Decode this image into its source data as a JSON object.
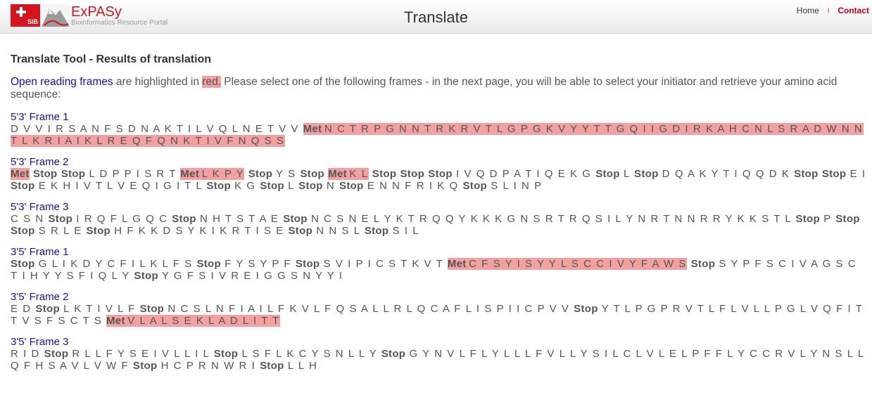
{
  "header": {
    "logo_sib": "SIB",
    "logo_name": "ExPASy",
    "logo_sub": "Bioinformatics Resource Portal",
    "title": "Translate",
    "nav": [
      {
        "label": "Home"
      },
      {
        "label": "Contact"
      }
    ],
    "nav_separator": "I"
  },
  "main": {
    "heading": "Translate Tool - Results of translation",
    "intro_link": "Open reading frames",
    "intro_mid": " are highlighted in ",
    "intro_red": "red.",
    "intro_rest": " Please select one of the following frames - in the next page, you will be able to select your initiator and retrieve your amino acid sequence:",
    "highlight_color": "#f2a0a0",
    "link_color": "#1a0fb0"
  },
  "frames": [
    {
      "title": "5'3' Frame 1",
      "sequence": "D V V I R S A N F S D N A K T I L V Q L N E T V V [Met N C T R P G N N T R K R V T L G P G K V Y Y T T G Q I I G D I R K A H C N L S R A D W N N T L K R I A I K L R E Q F Q N K T I V F N Q S S]"
    },
    {
      "title": "5'3' Frame 2",
      "sequence": "[Met] Stop Stop L D P P I S R T [Met L K P Y] Stop Y S Stop [Met K L] Stop Stop Stop I V Q D P A T I Q E K G Stop L Stop D Q A K Y T I Q Q D K Stop Stop E I Stop E K H I V T L V E Q I G I T L Stop K G Stop L Stop N Stop E N N F R I K Q Stop S L I N P"
    },
    {
      "title": "5'3' Frame 3",
      "sequence": "C S N Stop I R Q F L G Q C Stop N H T S T A E Stop N C S N E L Y K T R Q Q Y K K K G N S R T R Q S I L Y N R T N N R R Y K K S T L Stop P Stop Stop S R L E Stop H F K K D S Y K I K R T I S E Stop N N S L Stop S I L"
    },
    {
      "title": "3'5' Frame 1",
      "sequence": "Stop G L I K D Y C F I L K L F S Stop F Y S Y P F Stop S V I P I C S T K V T [Met C F S Y I S Y Y L S C C I V Y F A W S] Stop S Y P F S C I V A G S C T I H Y Y S F I Q L Y Stop Y G F S I V R E I G G S N Y Y I"
    },
    {
      "title": "3'5' Frame 2",
      "sequence": "E D Stop L K T I V L F Stop N C S L N F I A I L F K V L F Q S A L L R L Q C A F L I S P I I C P V V Stop Y T L P G P R V T L F L V L L P G L V Q F I T T V S F S C T S [Met V L A L S E K L A D L I T T]"
    },
    {
      "title": "3'5' Frame 3",
      "sequence": "R I D Stop R L L F Y S E I V L L I L Stop L S F L K C Y S N L L Y Stop G Y N V L F L Y L L L F V L L Y S I L C L V L E L P F F L Y C C R V L Y N S L L Q F H S A V L V W F Stop H C P R N W R I Stop L L H"
    }
  ]
}
